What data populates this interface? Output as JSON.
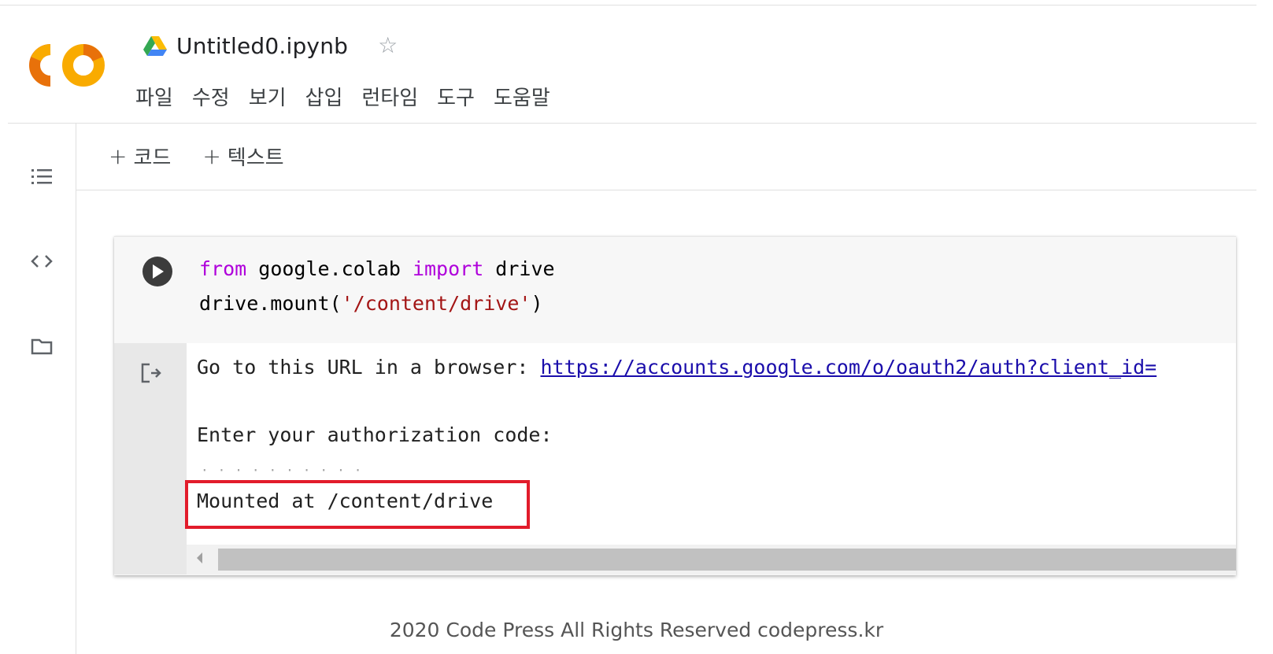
{
  "header": {
    "logo_text": "CO",
    "doc_title": "Untitled0.ipynb",
    "menu": [
      "파일",
      "수정",
      "보기",
      "삽입",
      "런타임",
      "도구",
      "도움말"
    ]
  },
  "toolbar": {
    "add_code": "코드",
    "add_text": "텍스트"
  },
  "cell": {
    "code_line1": {
      "kw1": "from",
      "mid": " google.colab ",
      "kw2": "import",
      "end": " drive"
    },
    "code_line2": {
      "pre": "drive.mount(",
      "str": "'/content/drive'",
      "post": ")"
    },
    "output": {
      "line1_text": "Go to this URL in a browser: ",
      "line1_link": "https://accounts.google.com/o/oauth2/auth?client_id=",
      "line2": "Enter your authorization code:",
      "dots": "··········",
      "line3": "Mounted at /content/drive"
    }
  },
  "footer": {
    "text": "2020 Code Press All Rights Reserved codepress.kr"
  },
  "colors": {
    "logo_orange": "#f9ab00",
    "logo_orange_dark": "#e8710a",
    "keyword": "#af00db",
    "string": "#a31515",
    "link": "#1a0dab",
    "highlight": "#e21c2b"
  }
}
